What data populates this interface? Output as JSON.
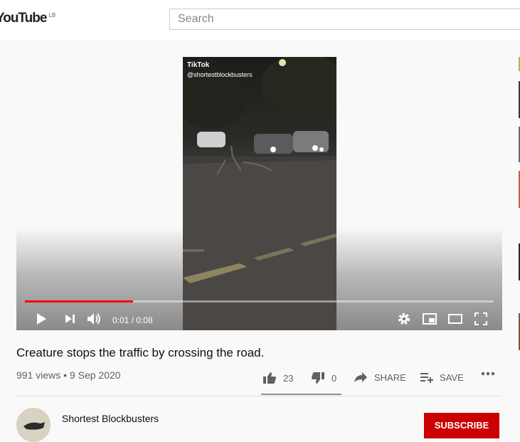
{
  "header": {
    "logo_text": "YouTube",
    "region": "LB",
    "search_placeholder": "Search"
  },
  "player": {
    "watermark_brand": "TikTok",
    "watermark_user": "@shortestblockbusters",
    "time_current": "0:01",
    "time_duration": "0:08",
    "progress_fraction": 0.23
  },
  "video": {
    "title": "Creature stops the traffic by crossing the road.",
    "views": "991 views",
    "separator": "•",
    "date": "9 Sep 2020",
    "likes": "23",
    "dislikes": "0",
    "share_label": "SHARE",
    "save_label": "SAVE"
  },
  "channel": {
    "name": "Shortest Blockbusters",
    "subscribe_label": "SUBSCRIBE"
  },
  "colors": {
    "accent": "#ff0000",
    "subscribe_bg": "#cc0000"
  }
}
